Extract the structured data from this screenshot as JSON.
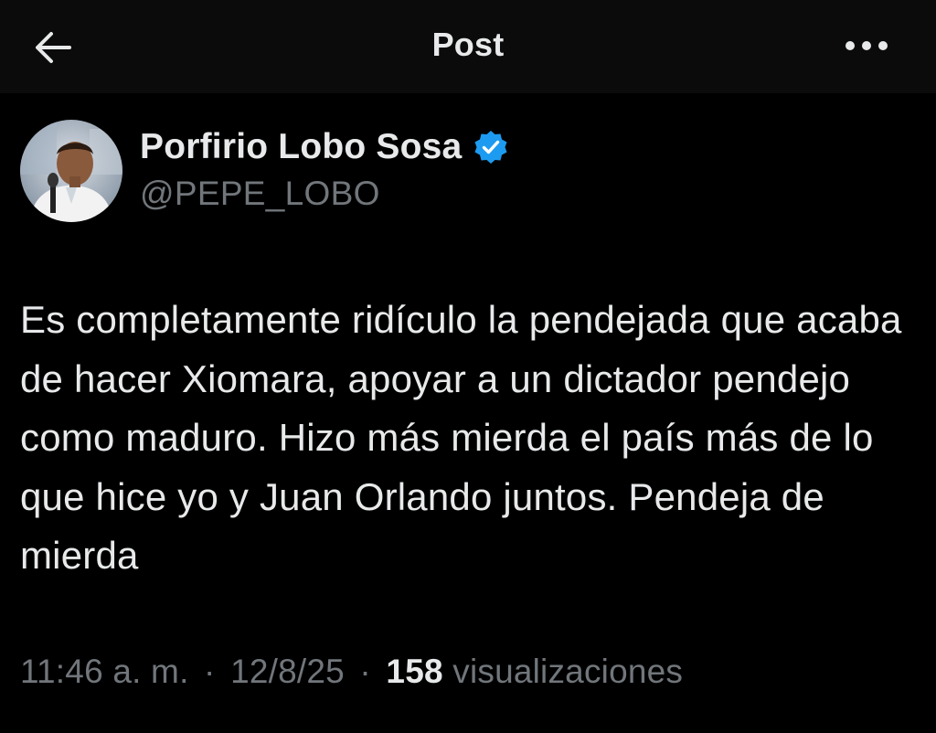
{
  "header": {
    "title": "Post",
    "back_icon": "arrow-left-icon",
    "more_icon": "more-horizontal-icon"
  },
  "author": {
    "name": "Porfirio Lobo Sosa",
    "handle": "@PEPE_LOBO",
    "verified_icon": "verified-badge-icon",
    "verified_color": "#1d9bf0"
  },
  "post": {
    "text": "Es completamente ridículo la pendejada que acaba de hacer Xiomara, apoyar a un dictador pendejo como maduro. Hizo más mierda el país más de lo que hice yo y Juan Orlando juntos. Pendeja de mierda"
  },
  "meta": {
    "time": "11:46 a. m.",
    "separator": "·",
    "date": "12/8/25",
    "views_count": "158",
    "views_label": "visualizaciones"
  },
  "colors": {
    "background": "#000000",
    "topbar": "#0b0b0b",
    "text_primary": "#e7e9ea",
    "text_secondary": "#71767b"
  }
}
